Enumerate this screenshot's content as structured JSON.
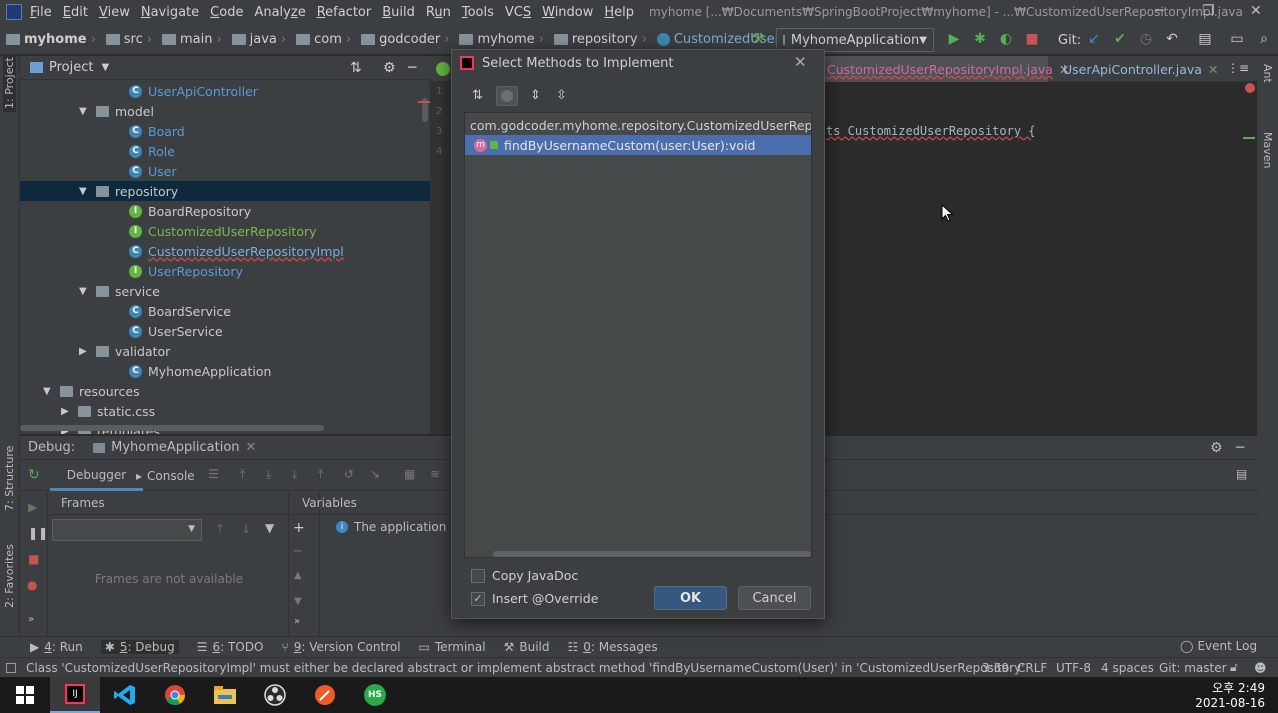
{
  "menubar": {
    "items": [
      {
        "pre": "",
        "u": "F",
        "post": "ile"
      },
      {
        "pre": "",
        "u": "E",
        "post": "dit"
      },
      {
        "pre": "",
        "u": "V",
        "post": "iew"
      },
      {
        "pre": "",
        "u": "N",
        "post": "avigate"
      },
      {
        "pre": "",
        "u": "C",
        "post": "ode"
      },
      {
        "pre": "Analy",
        "u": "z",
        "post": "e"
      },
      {
        "pre": "",
        "u": "R",
        "post": "efactor"
      },
      {
        "pre": "",
        "u": "B",
        "post": "uild"
      },
      {
        "pre": "R",
        "u": "u",
        "post": "n"
      },
      {
        "pre": "",
        "u": "T",
        "post": "ools"
      },
      {
        "pre": "VC",
        "u": "S",
        "post": ""
      },
      {
        "pre": "",
        "u": "W",
        "post": "indow"
      },
      {
        "pre": "",
        "u": "H",
        "post": "elp"
      }
    ],
    "title": "myhome [...₩Documents₩SpringBootProject₩myhome] - ...₩CustomizedUserRepositoryImpl.java"
  },
  "breadcrumbs": [
    "myhome",
    "src",
    "main",
    "java",
    "com",
    "godcoder",
    "myhome",
    "repository",
    "CustomizedUserRepositoryImpl"
  ],
  "run_config": "MyhomeApplication",
  "git_label": "Git:",
  "project": {
    "title": "Project",
    "tree": [
      {
        "label": "UserApiController",
        "icon": "class",
        "style": "blue",
        "indent": 129
      },
      {
        "label": "model",
        "icon": "folder",
        "tri": "▼",
        "indent": 93
      },
      {
        "label": "Board",
        "icon": "class",
        "style": "blue",
        "indent": 129
      },
      {
        "label": "Role",
        "icon": "class",
        "style": "blue",
        "indent": 129
      },
      {
        "label": "User",
        "icon": "class",
        "style": "blue",
        "indent": 129
      },
      {
        "label": "repository",
        "icon": "folder",
        "tri": "▼",
        "indent": 93,
        "selected": true
      },
      {
        "label": "BoardRepository",
        "icon": "interface",
        "style": "plain",
        "indent": 129
      },
      {
        "label": "CustomizedUserRepository",
        "icon": "interface",
        "style": "green",
        "indent": 129
      },
      {
        "label": "CustomizedUserRepositoryImpl",
        "icon": "class",
        "style": "err",
        "indent": 129
      },
      {
        "label": "UserRepository",
        "icon": "interface",
        "style": "blue",
        "indent": 129
      },
      {
        "label": "service",
        "icon": "folder",
        "tri": "▼",
        "indent": 93
      },
      {
        "label": "BoardService",
        "icon": "class",
        "style": "plain",
        "indent": 129
      },
      {
        "label": "UserService",
        "icon": "class",
        "style": "plain",
        "indent": 129
      },
      {
        "label": "validator",
        "icon": "folder",
        "tri": "▶",
        "indent": 93
      },
      {
        "label": "MyhomeApplication",
        "icon": "class",
        "style": "plain",
        "indent": 129
      },
      {
        "label": "resources",
        "icon": "folder",
        "tri": "▼",
        "indent": 57
      },
      {
        "label": "static.css",
        "icon": "folder",
        "tri": "▶",
        "indent": 75
      },
      {
        "label": "templates",
        "icon": "folder",
        "tri": "▶",
        "indent": 75
      }
    ]
  },
  "editor": {
    "tabs": [
      {
        "label": "CustomizedUserRepositoryImpl.java",
        "active": true
      },
      {
        "label": "UserApiController.java",
        "active": false
      }
    ],
    "line_numbers": [
      "1",
      "2",
      "3",
      "4"
    ],
    "code_fragment": "ts CustomizedUserRepository {"
  },
  "debug": {
    "label": "Debug:",
    "session": "MyhomeApplication",
    "tabs": [
      "Debugger",
      "Console"
    ],
    "frames_label": "Frames",
    "variables_label": "Variables",
    "frames_empty": "Frames are not available",
    "info": "The application is"
  },
  "left_tools": [
    "1: Project",
    "7: Structure",
    "2: Favorites"
  ],
  "right_tools": [
    "Ant",
    "Maven"
  ],
  "bottom_tabs": [
    {
      "num": "4",
      "label": ": Run"
    },
    {
      "num": "5",
      "label": ": Debug"
    },
    {
      "num": "6",
      "label": ": TODO"
    },
    {
      "num": "9",
      "label": ": Version Control"
    },
    {
      "num": "",
      "label": "Terminal"
    },
    {
      "num": "",
      "label": "Build"
    },
    {
      "num": "0",
      "label": ": Messages"
    }
  ],
  "event_log": "Event Log",
  "status": {
    "message": "Class 'CustomizedUserRepositoryImpl' must either be declared abstract or implement abstract method 'findByUsernameCustom(User)' in 'CustomizedUserRepository'",
    "pos": "3:69",
    "crlf": "CRLF",
    "enc": "UTF-8",
    "indent": "4 spaces",
    "git": "Git: master"
  },
  "dialog": {
    "title": "Select Methods to Implement",
    "interface": "com.godcoder.myhome.repository.CustomizedUserRepository",
    "method": "findByUsernameCustom(user:User):void",
    "copy_javadoc": "Copy JavaDoc",
    "insert_override": "Insert @Override",
    "ok": "OK",
    "cancel": "Cancel"
  },
  "taskbar": {
    "time": "오후 2:49",
    "date": "2021-08-16"
  },
  "colors": {
    "accent": "#4b6eaf",
    "selected_row": "#0d293e",
    "error": "#d04a4a"
  }
}
